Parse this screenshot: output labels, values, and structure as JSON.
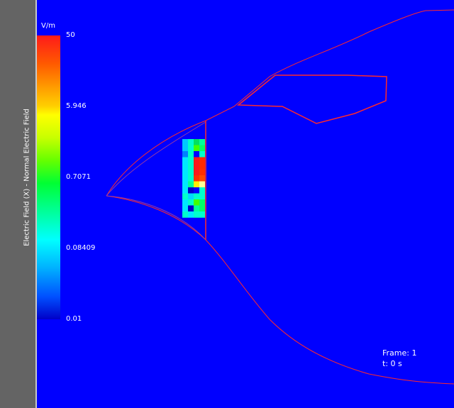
{
  "colorbar": {
    "unit": "V/m",
    "title": "Electric Field (X) - Normal Electric Field",
    "ticks": [
      "50",
      "5.946",
      "0.7071",
      "0.08409",
      "0.01"
    ]
  },
  "frame": {
    "label": "Frame: 1",
    "time": "t: 0 s"
  },
  "colors": {
    "background": "#0000ff",
    "outline": "#ff2a2a",
    "panel": "#646464"
  },
  "field_patch": {
    "columns": 4,
    "rows": 13,
    "cells": [
      "#00c8ff",
      "#00ffcc",
      "#00e060",
      "#00ff99",
      "#00c8ff",
      "#00ffcc",
      "#40ff00",
      "#00ff66",
      "#0080ff",
      "#00ffcc",
      "#0000ff",
      "#00ffcc",
      "#00e8ff",
      "#00ffcc",
      "#ff1a1a",
      "#ff2a00",
      "#00e8ff",
      "#00ffcc",
      "#ff1a1a",
      "#ff2a00",
      "#00e8ff",
      "#00ffcc",
      "#ff1a1a",
      "#ff3000",
      "#00e8ff",
      "#00ffcc",
      "#ff3000",
      "#ff4a00",
      "#00e8ff",
      "#00ff99",
      "#ffee00",
      "#ffff99",
      "#00e8ff",
      "#0000c8",
      "#0000ff",
      "#00ffcc",
      "#00ffcc",
      "#00d8ff",
      "#00ffcc",
      "#00ffcc",
      "#00e8ff",
      "#00ffcc",
      "#40ff00",
      "#00ff66",
      "#00e8ff",
      "#0000c8",
      "#00ff99",
      "#00ff66",
      "#00ffcc",
      "#00e8ff",
      "#00ffcc",
      "#00ffcc"
    ]
  }
}
